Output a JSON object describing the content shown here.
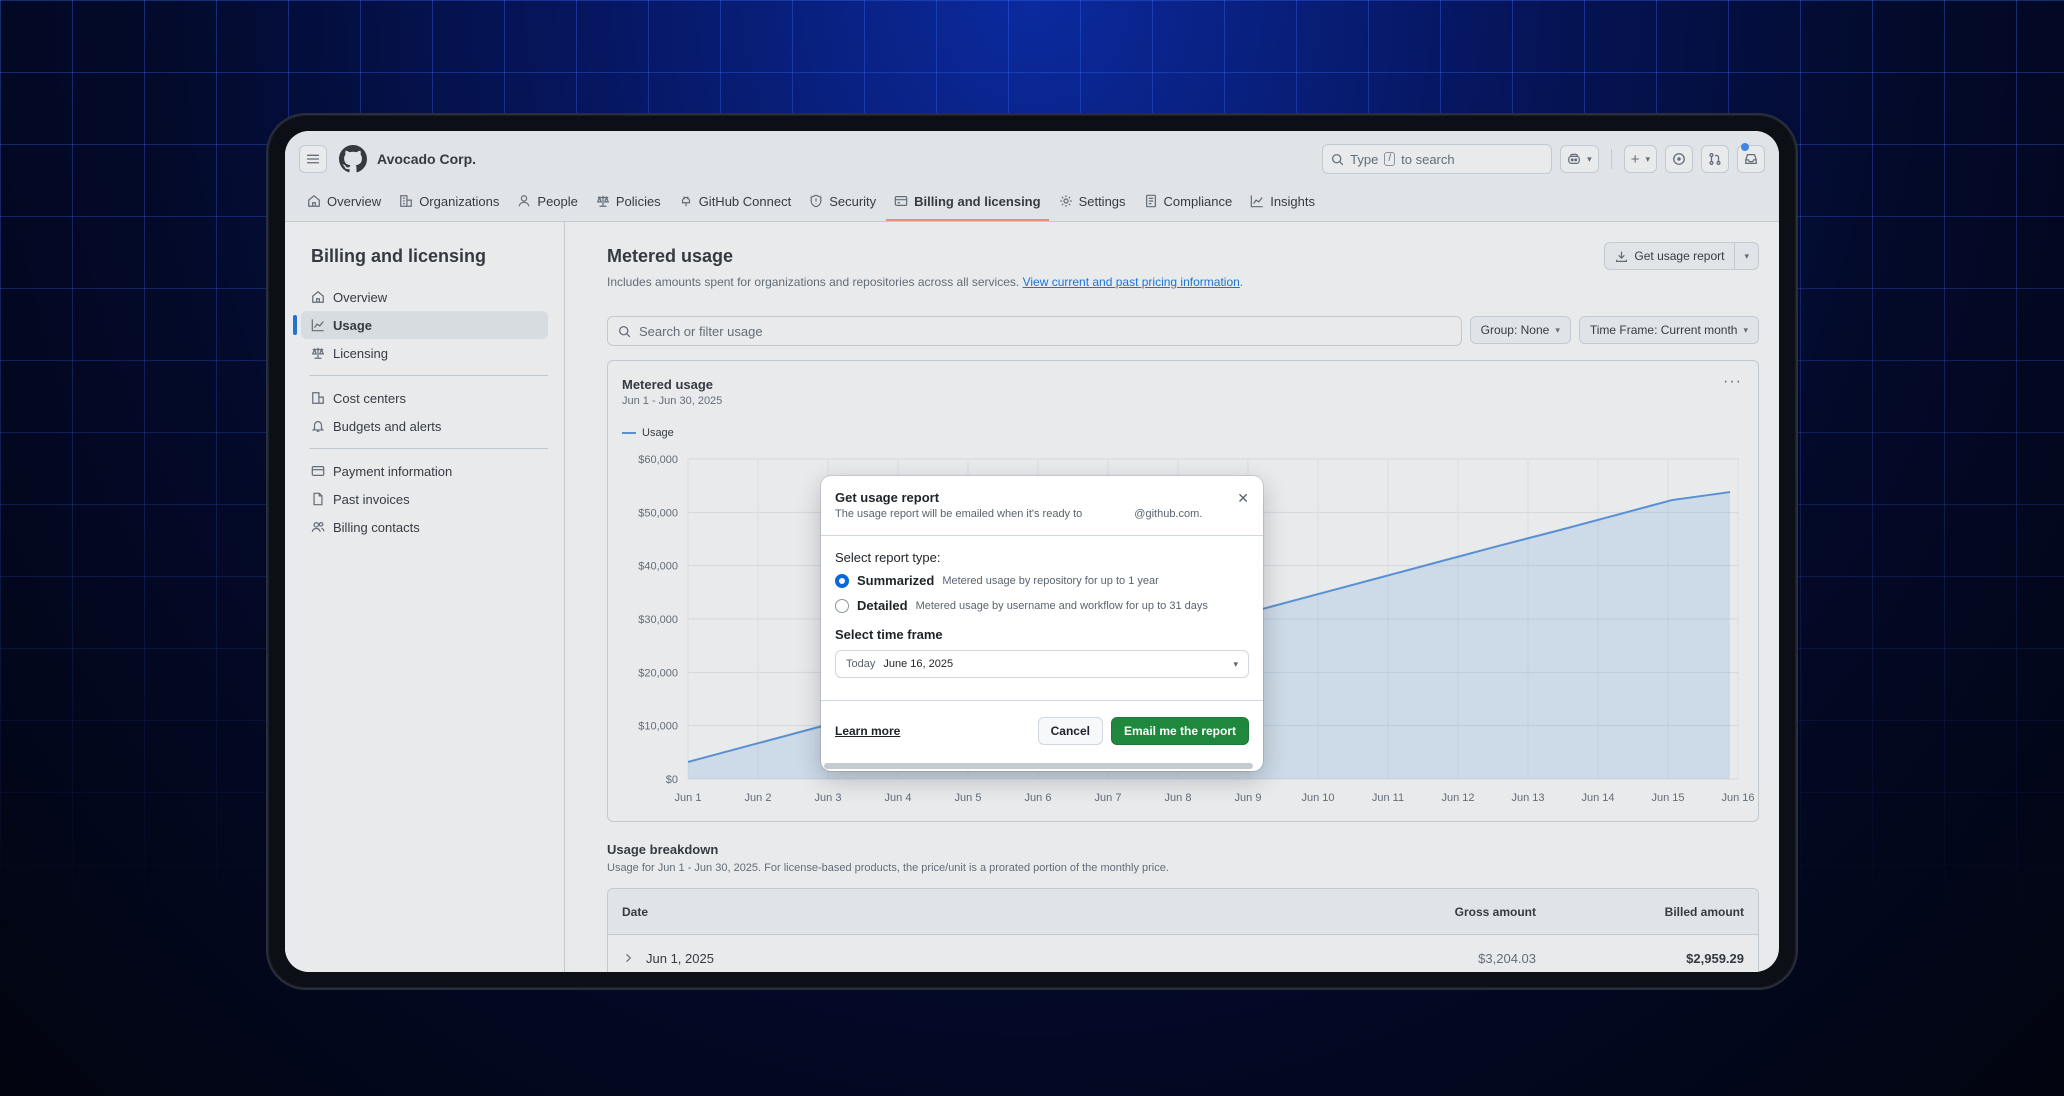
{
  "header": {
    "org_name": "Avocado Corp.",
    "search_prefix": "Type",
    "search_key": "/",
    "search_suffix": "to search"
  },
  "tabs": [
    {
      "label": "Overview",
      "icon": "home-icon"
    },
    {
      "label": "Organizations",
      "icon": "organization-icon"
    },
    {
      "label": "People",
      "icon": "person-icon"
    },
    {
      "label": "Policies",
      "icon": "law-icon"
    },
    {
      "label": "GitHub Connect",
      "icon": "plug-icon"
    },
    {
      "label": "Security",
      "icon": "shield-icon"
    },
    {
      "label": "Billing and licensing",
      "icon": "credit-card-icon",
      "active": true
    },
    {
      "label": "Settings",
      "icon": "gear-icon"
    },
    {
      "label": "Compliance",
      "icon": "checklist-icon"
    },
    {
      "label": "Insights",
      "icon": "graph-icon"
    }
  ],
  "sidebar": {
    "title": "Billing and licensing",
    "items": [
      {
        "label": "Overview",
        "icon": "home-icon"
      },
      {
        "label": "Usage",
        "icon": "graph-icon",
        "active": true
      },
      {
        "label": "Licensing",
        "icon": "law-icon"
      },
      {
        "label": "Cost centers",
        "icon": "organization-icon"
      },
      {
        "label": "Budgets and alerts",
        "icon": "bell-icon"
      },
      {
        "label": "Payment information",
        "icon": "credit-card-icon"
      },
      {
        "label": "Past invoices",
        "icon": "file-icon"
      },
      {
        "label": "Billing contacts",
        "icon": "people-icon"
      }
    ]
  },
  "main": {
    "title": "Metered usage",
    "subtitle": "Includes amounts spent for organizations and repositories across all services.",
    "subtitle_link": "View current and past pricing information",
    "subtitle_end": ".",
    "get_report_label": "Get usage report",
    "search_placeholder": "Search or filter usage",
    "group_label": "Group: None",
    "timeframe_label": "Time Frame: Current month"
  },
  "chart_card": {
    "title": "Metered usage",
    "subtitle": "Jun 1 - Jun 30, 2025",
    "menu": "···"
  },
  "chart_data": {
    "type": "area",
    "title": "Metered usage",
    "subtitle": "Jun 1 - Jun 30, 2025",
    "series": [
      {
        "name": "Usage",
        "values": [
          3204,
          6100,
          9000,
          11900,
          14800,
          17700,
          20600,
          23500,
          26400,
          29300,
          32100,
          35000,
          37900,
          40800,
          43700,
          46500,
          49400,
          52300,
          53800
        ]
      }
    ],
    "x": [
      "Jun 1",
      "Jun 2",
      "Jun 3",
      "Jun 4",
      "Jun 5",
      "Jun 6",
      "Jun 7",
      "Jun 8",
      "Jun 9",
      "Jun 10",
      "Jun 11",
      "Jun 12",
      "Jun 13",
      "Jun 14",
      "Jun 15",
      "Jun 16"
    ],
    "yticks": [
      "$0",
      "$10,000",
      "$20,000",
      "$30,000",
      "$40,000",
      "$50,000",
      "$60,000"
    ],
    "ylim": [
      0,
      60000
    ],
    "grid": true,
    "color": "#4a8fe0",
    "legend": "top-left"
  },
  "breakdown": {
    "title": "Usage breakdown",
    "subtitle": "Usage for Jun 1 - Jun 30, 2025. For license-based products, the price/unit is a prorated portion of the monthly price.",
    "headers": {
      "date": "Date",
      "gross": "Gross amount",
      "billed": "Billed amount"
    },
    "rows": [
      {
        "date": "Jun 1, 2025",
        "gross": "$3,204.03",
        "billed": "$2,959.29"
      }
    ]
  },
  "dialog": {
    "title": "Get usage report",
    "desc_before": "The usage report will be emailed when it's ready to",
    "desc_after": "@github.com.",
    "report_type_label": "Select report type:",
    "options": [
      {
        "title": "Summarized",
        "desc": "Metered usage by repository for up to 1 year",
        "selected": true
      },
      {
        "title": "Detailed",
        "desc": "Metered usage by username and workflow for up to 31 days",
        "selected": false
      }
    ],
    "timeframe_label": "Select time frame",
    "timeframe_tag": "Today",
    "timeframe_value": "June 16, 2025",
    "learn_more": "Learn more",
    "cancel": "Cancel",
    "submit": "Email me the report"
  },
  "colors": {
    "accent": "#0969da",
    "primary_button": "#1f883d",
    "tab_underline": "#fd8c73"
  }
}
